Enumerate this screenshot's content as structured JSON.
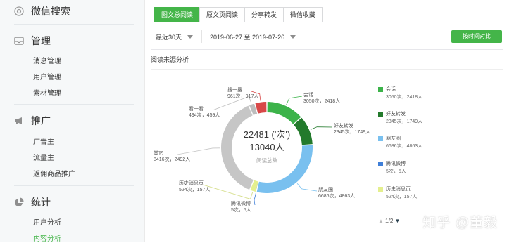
{
  "sidebar": {
    "sections": [
      {
        "title": "微信搜索",
        "icon": "search-icon"
      },
      {
        "title": "管理",
        "icon": "inbox-icon",
        "items": [
          "消息管理",
          "用户管理",
          "素材管理"
        ]
      },
      {
        "title": "推广",
        "icon": "megaphone-icon",
        "items": [
          "广告主",
          "流量主",
          "返佣商品推广"
        ]
      },
      {
        "title": "统计",
        "icon": "pie-chart-icon",
        "items": [
          "用户分析",
          "内容分析"
        ],
        "active_item": "内容分析"
      }
    ]
  },
  "tabs": [
    "图文总阅读",
    "原文页阅读",
    "分享转发",
    "微信收藏"
  ],
  "active_tab": "图文总阅读",
  "filter": {
    "period": "最近30天",
    "date_range": "2019-06-27 至 2019-07-26",
    "compare_button": "按时间对比"
  },
  "panel_title": "阅读来源分析",
  "chart_data": {
    "type": "pie",
    "title": "阅读来源分析",
    "center": {
      "total_reads": "22481 ('次')",
      "total_users": "13040人",
      "caption": "阅读总数"
    },
    "slices": [
      {
        "name": "会话",
        "reads": 3050,
        "users": 2418,
        "label": "3050次，2418人",
        "color": "#3cb34a"
      },
      {
        "name": "好友转发",
        "reads": 2345,
        "users": 1749,
        "label": "2345次，1749人",
        "color": "#237a2c"
      },
      {
        "name": "朋友圈",
        "reads": 6686,
        "users": 4863,
        "label": "6686次，4863人",
        "color": "#79c0ef"
      },
      {
        "name": "腾讯微博",
        "reads": 5,
        "users": 5,
        "label": "5次，5人",
        "color": "#3f7fd8"
      },
      {
        "name": "历史消息页",
        "reads": 524,
        "users": 157,
        "label": "524次，157人",
        "color": "#e4ef8e"
      },
      {
        "name": "其它",
        "reads": 8416,
        "users": 2492,
        "label": "8416次，2492人",
        "color": "#c6c6c6"
      },
      {
        "name": "看一看",
        "reads": 494,
        "users": 459,
        "label": "494次，459人",
        "color": "#bdbdbd"
      },
      {
        "name": "搜一搜",
        "reads": 961,
        "users": 917,
        "label": "961次，917人",
        "color": "#d84848"
      }
    ]
  },
  "legend": [
    {
      "name": "会话",
      "label": "3050次，2418人",
      "color": "#3cb34a"
    },
    {
      "name": "好友转发",
      "label": "2345次，1749人",
      "color": "#237a2c"
    },
    {
      "name": "朋友圈",
      "label": "6686次，4863人",
      "color": "#79c0ef"
    },
    {
      "name": "腾讯微博",
      "label": "5次，5人",
      "color": "#3f7fd8"
    },
    {
      "name": "历史消息页",
      "label": "524次，157人",
      "color": "#e4ef8e"
    }
  ],
  "pager": "1/2",
  "watermark": "知乎 @董毅"
}
